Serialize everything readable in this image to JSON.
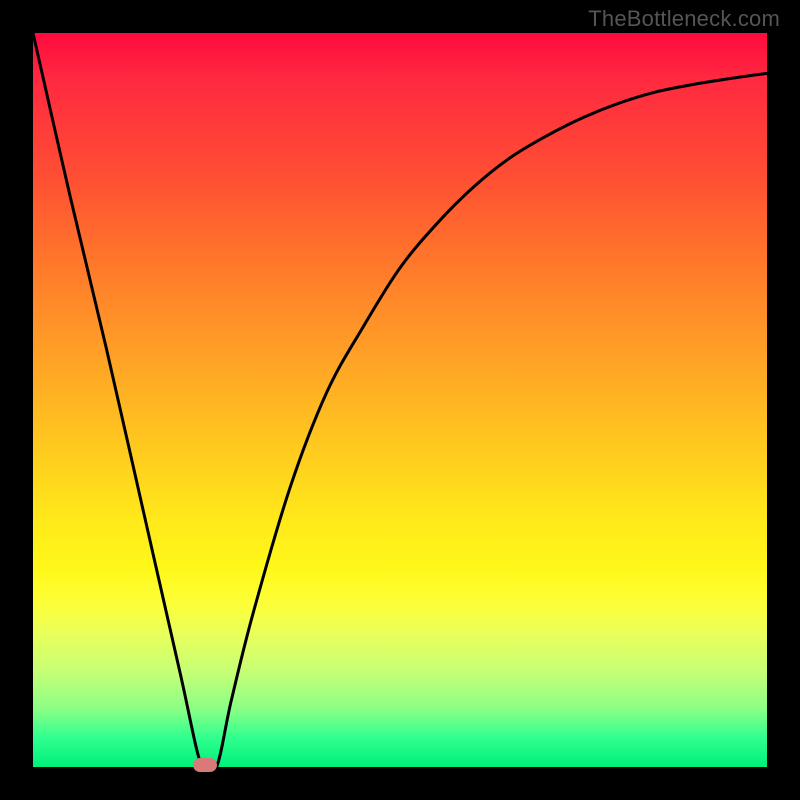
{
  "watermark": "TheBottleneck.com",
  "colors": {
    "frame_border": "#000000",
    "curve": "#000000",
    "marker": "#d87a7a"
  },
  "chart_data": {
    "type": "line",
    "title": "",
    "xlabel": "",
    "ylabel": "",
    "xlim": [
      0,
      100
    ],
    "ylim": [
      0,
      100
    ],
    "grid": false,
    "series": [
      {
        "name": "bottleneck-curve",
        "x": [
          0,
          5,
          10,
          15,
          20,
          23,
          25,
          27,
          30,
          35,
          40,
          45,
          50,
          55,
          60,
          65,
          70,
          75,
          80,
          85,
          90,
          95,
          100
        ],
        "y": [
          100,
          78,
          57,
          35,
          13,
          0,
          0,
          9,
          21,
          38,
          51,
          60,
          68,
          74,
          79,
          83,
          86,
          88.5,
          90.5,
          92,
          93,
          93.8,
          94.5
        ]
      }
    ],
    "marker": {
      "x": 23.5,
      "y": 0
    },
    "gradient_stops": [
      {
        "pos": 0.0,
        "color": "#ff0a3e"
      },
      {
        "pos": 0.2,
        "color": "#ff5033"
      },
      {
        "pos": 0.44,
        "color": "#ffa126"
      },
      {
        "pos": 0.66,
        "color": "#ffe81a"
      },
      {
        "pos": 0.82,
        "color": "#e8ff5c"
      },
      {
        "pos": 0.96,
        "color": "#30ff8e"
      },
      {
        "pos": 1.0,
        "color": "#00f07a"
      }
    ]
  }
}
